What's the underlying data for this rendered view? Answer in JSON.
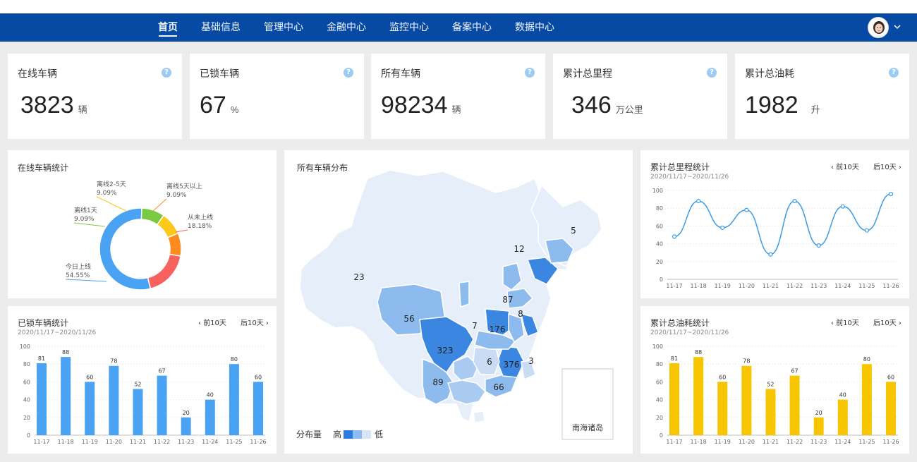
{
  "nav": {
    "items": [
      "首页",
      "基础信息",
      "管理中心",
      "金融中心",
      "监控中心",
      "备案中心",
      "数据中心"
    ],
    "active": 0
  },
  "stats": [
    {
      "title": "在线车辆",
      "value": "3823",
      "unit": "辆"
    },
    {
      "title": "已锁车辆",
      "value": "67",
      "unit": "%"
    },
    {
      "title": "所有车辆",
      "value": "98234",
      "unit": "辆"
    },
    {
      "title": "累计总里程",
      "value": "346",
      "unit": "万公里"
    },
    {
      "title": "累计总油耗",
      "value": "1982",
      "unit": "升"
    }
  ],
  "help_glyph": "?",
  "online_panel": {
    "title": "在线车辆统计",
    "chart_data": {
      "type": "pie",
      "slices": [
        {
          "label": "今日上线",
          "percent": "54.55%",
          "value": 54.55,
          "color": "#4aa3f2"
        },
        {
          "label": "离线1天",
          "percent": "9.09%",
          "value": 9.09,
          "color": "#7ac943"
        },
        {
          "label": "离线2-5天",
          "percent": "9.09%",
          "value": 9.09,
          "color": "#fcc81a"
        },
        {
          "label": "离线5天以上",
          "percent": "9.09%",
          "value": 9.09,
          "color": "#ff8a1f"
        },
        {
          "label": "从未上线",
          "percent": "18.18%",
          "value": 18.18,
          "color": "#f8625e"
        }
      ]
    }
  },
  "map_panel": {
    "title": "所有车辆分布",
    "legend_label": "分布量",
    "legend_high": "高",
    "legend_low": "低",
    "inset_label": "南海诸岛",
    "region_values": [
      "5",
      "12",
      "23",
      "56",
      "87",
      "8",
      "7",
      "176",
      "323",
      "6",
      "376",
      "3",
      "89",
      "66"
    ]
  },
  "mileage_panel": {
    "title": "累计总里程统计",
    "date_range": "2020/11/17~2020/11/26",
    "prev": "前10天",
    "next": "后10天",
    "chart_data": {
      "type": "line",
      "categories": [
        "11-17",
        "11-18",
        "11-19",
        "11-20",
        "11-21",
        "11-22",
        "11-23",
        "11-24",
        "11-25",
        "11-26"
      ],
      "values": [
        48,
        88,
        58,
        78,
        28,
        88,
        38,
        82,
        55,
        96
      ],
      "ylim": [
        0,
        100
      ],
      "yticks": [
        0,
        20,
        40,
        60,
        80,
        100
      ],
      "color": "#3a9be6"
    }
  },
  "locked_panel": {
    "title": "已锁车辆统计",
    "date_range": "2020/11/17~2020/11/26",
    "prev": "前10天",
    "next": "后10天",
    "chart_data": {
      "type": "bar",
      "categories": [
        "11-17",
        "11-18",
        "11-19",
        "11-20",
        "11-21",
        "11-22",
        "11-23",
        "11-24",
        "11-25",
        "11-26"
      ],
      "values": [
        81,
        88,
        60,
        78,
        52,
        67,
        20,
        40,
        80,
        60
      ],
      "ylim": [
        0,
        100
      ],
      "yticks": [
        0,
        20,
        40,
        60,
        80,
        100
      ],
      "color": "#4aa3f2"
    }
  },
  "fuel_panel": {
    "title": "累计总油耗统计",
    "date_range": "2020/11/17~2020/11/26",
    "prev": "前10天",
    "next": "后10天",
    "chart_data": {
      "type": "bar",
      "categories": [
        "11-17",
        "11-18",
        "11-19",
        "11-20",
        "11-21",
        "11-22",
        "11-23",
        "11-24",
        "11-25",
        "11-26"
      ],
      "values": [
        81,
        88,
        60,
        78,
        52,
        67,
        20,
        40,
        80,
        60
      ],
      "ylim": [
        0,
        100
      ],
      "yticks": [
        0,
        20,
        40,
        60,
        80,
        100
      ],
      "color": "#f7c600"
    }
  }
}
